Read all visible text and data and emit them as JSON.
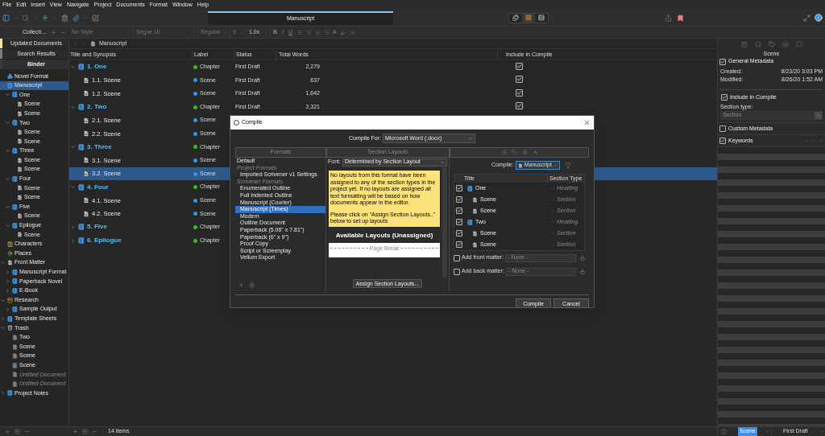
{
  "menu": [
    "File",
    "Edit",
    "Insert",
    "View",
    "Navigate",
    "Project",
    "Documents",
    "Format",
    "Window",
    "Help"
  ],
  "toolbar": {
    "title": "Manuscript",
    "view_modes": [
      {
        "kind": "pages",
        "selected": false
      },
      {
        "kind": "grid",
        "selected": true
      },
      {
        "kind": "rows",
        "selected": false
      }
    ]
  },
  "format_bar": {
    "style": "No Style",
    "font": "Segoe UI",
    "weight": "Regular",
    "size": "9",
    "spacing": "1.0x",
    "bold": "B",
    "italic": "I",
    "underline": "U",
    "text_color": "A"
  },
  "binder": {
    "header": "Collecti…",
    "collections": [
      {
        "label": "Updated Documents",
        "color": "#f3e5ab",
        "selected": false
      },
      {
        "label": "Search Results",
        "color": "#7a7a7a",
        "selected": false
      },
      {
        "label": "Binder",
        "color": "#3a3a3a",
        "selected": true
      }
    ],
    "items": [
      {
        "title": "Novel Format",
        "kind": "format",
        "selected": false
      },
      {
        "title": "Manuscript",
        "kind": "folder",
        "expanded": true,
        "selected": true,
        "children": [
          {
            "title": "One",
            "kind": "folder",
            "expanded": true,
            "selected": false,
            "children": [
              {
                "title": "Scene",
                "kind": "scene",
                "selected": false
              },
              {
                "title": "Scene",
                "kind": "scene",
                "selected": false
              }
            ]
          },
          {
            "title": "Two",
            "kind": "folder",
            "expanded": true,
            "selected": false,
            "children": [
              {
                "title": "Scene",
                "kind": "scene",
                "selected": false
              },
              {
                "title": "Scene",
                "kind": "scene",
                "selected": false
              }
            ]
          },
          {
            "title": "Three",
            "kind": "folder",
            "expanded": true,
            "selected": false,
            "children": [
              {
                "title": "Scene",
                "kind": "scene",
                "selected": false
              },
              {
                "title": "Scene",
                "kind": "scene",
                "selected": false
              }
            ]
          },
          {
            "title": "Four",
            "kind": "folder",
            "expanded": true,
            "selected": false,
            "children": [
              {
                "title": "Scene",
                "kind": "scene",
                "selected": false
              },
              {
                "title": "Scene",
                "kind": "scene",
                "selected": false
              }
            ]
          },
          {
            "title": "Five",
            "kind": "folder",
            "expanded": true,
            "selected": false,
            "children": [
              {
                "title": "Scene",
                "kind": "scene",
                "selected": false
              }
            ]
          },
          {
            "title": "Epilogue",
            "kind": "folder",
            "expanded": true,
            "selected": false,
            "children": [
              {
                "title": "Scene",
                "kind": "scene",
                "selected": false
              }
            ]
          }
        ]
      },
      {
        "title": "Characters",
        "kind": "characters",
        "selected": false
      },
      {
        "title": "Places",
        "kind": "places",
        "selected": false
      },
      {
        "title": "Front Matter",
        "kind": "scene",
        "expanded": true,
        "selected": false,
        "children": [
          {
            "title": "Manuscript Format",
            "kind": "folder",
            "expanded": false,
            "selected": false
          },
          {
            "title": "Paperback Novel",
            "kind": "folder",
            "expanded": false,
            "selected": false
          },
          {
            "title": "E-Book",
            "kind": "folder",
            "expanded": false,
            "selected": false
          }
        ]
      },
      {
        "title": "Research",
        "kind": "research",
        "expanded": true,
        "selected": false,
        "children": [
          {
            "title": "Sample Output",
            "kind": "folder",
            "expanded": false,
            "selected": false
          }
        ]
      },
      {
        "title": "Template Sheets",
        "kind": "folder",
        "expanded": false,
        "selected": false
      },
      {
        "title": "Trash",
        "kind": "trash",
        "expanded": true,
        "selected": false,
        "children": [
          {
            "title": "Two",
            "kind": "trashed",
            "selected": false
          },
          {
            "title": "Scene",
            "kind": "trashed",
            "selected": false
          },
          {
            "title": "Scene",
            "kind": "trashed",
            "selected": false
          },
          {
            "title": "Scene",
            "kind": "trashed-folder",
            "selected": false
          },
          {
            "title": "Untitled Document",
            "kind": "trashed",
            "dimmed": true,
            "selected": false
          },
          {
            "title": "Untitled Document",
            "kind": "trashed",
            "dimmed": true,
            "selected": false
          }
        ]
      },
      {
        "title": "Project Notes",
        "kind": "folder",
        "expanded": false,
        "selected": false
      }
    ]
  },
  "editor": {
    "breadcrumb": "Manuscript",
    "columns": [
      "Title and Synopsis",
      "Label",
      "Status",
      "Total Words",
      "Include in Compile"
    ],
    "rows": [
      {
        "title": "1. One",
        "kind": "chapter",
        "expanded": true,
        "label": "Chapter",
        "color": "#3cb521",
        "status": "First Draft",
        "words": "2,279",
        "include": true,
        "selected": false
      },
      {
        "title": "1.1. Scene",
        "kind": "scene",
        "label": "Scene",
        "color": "#3b8eea",
        "status": "First Draft",
        "words": "637",
        "include": true,
        "selected": false
      },
      {
        "title": "1.2. Scene",
        "kind": "scene",
        "label": "Scene",
        "color": "#3b8eea",
        "status": "First Draft",
        "words": "1,642",
        "include": true,
        "selected": false
      },
      {
        "title": "2. Two",
        "kind": "chapter",
        "expanded": true,
        "label": "Chapter",
        "color": "#3cb521",
        "status": "First Draft",
        "words": "2,321",
        "include": true,
        "selected": false
      },
      {
        "title": "2.1. Scene",
        "kind": "scene",
        "label": "Scene",
        "color": "#3b8eea",
        "selected": false
      },
      {
        "title": "2.2. Scene",
        "kind": "scene",
        "label": "Scene",
        "color": "#3b8eea",
        "selected": false
      },
      {
        "title": "3. Three",
        "kind": "chapter",
        "expanded": true,
        "label": "Chapter",
        "color": "#3cb521",
        "selected": false
      },
      {
        "title": "3.1. Scene",
        "kind": "scene",
        "label": "Scene",
        "color": "#3b8eea",
        "selected": false
      },
      {
        "title": "3.2. Scene",
        "kind": "scene",
        "label": "Scene",
        "color": "#3b8eea",
        "selected": true
      },
      {
        "title": "4. Four",
        "kind": "chapter",
        "expanded": true,
        "label": "Chapter",
        "color": "#3cb521",
        "selected": false
      },
      {
        "title": "4.1. Scene",
        "kind": "scene",
        "label": "Scene",
        "color": "#3b8eea",
        "selected": false
      },
      {
        "title": "4.2. Scene",
        "kind": "scene",
        "label": "Scene",
        "color": "#3b8eea",
        "selected": false
      },
      {
        "title": "5. Five",
        "kind": "chapter",
        "expanded": false,
        "label": "Chapter",
        "color": "#3cb521",
        "selected": false
      },
      {
        "title": "6. Epilogue",
        "kind": "chapter",
        "expanded": false,
        "label": "Chapter",
        "color": "#3cb521",
        "selected": false
      }
    ],
    "count": "14 items"
  },
  "inspector": {
    "title": "Scene",
    "general": {
      "label": "General Metadata",
      "checked": true
    },
    "created_label": "Created:",
    "created": "8/23/20 3:03 PM",
    "modified_label": "Modified:",
    "modified": "8/26/20 1:52 AM",
    "include": {
      "label": "Include in Compile",
      "checked": true
    },
    "section_type_label": "Section type:",
    "section_type": "Section",
    "section_type_disabled": true,
    "custom": {
      "label": "Custom Metadata",
      "checked": false
    },
    "keywords": {
      "label": "Keywords",
      "checked": true
    },
    "footer_label": "Scene",
    "footer_status": "First Draft"
  },
  "compile_dialog": {
    "title": "Compile",
    "compile_for_label": "Compile For:",
    "compile_for": "Microsoft Word (.docx)",
    "formats_header": "Formats",
    "layouts_header": "Section Layouts",
    "formats": [
      {
        "text": "Default",
        "kind": "top",
        "selected": false
      },
      {
        "text": "Project Formats",
        "kind": "group",
        "selected": false
      },
      {
        "text": "Imported Scrivener v1 Settings",
        "kind": "item",
        "selected": false
      },
      {
        "text": "Scrivener Formats",
        "kind": "group",
        "selected": false
      },
      {
        "text": "Enumerated Outline",
        "kind": "item",
        "selected": false
      },
      {
        "text": "Full Indented Outline",
        "kind": "item",
        "selected": false
      },
      {
        "text": "Manuscript (Courier)",
        "kind": "item",
        "selected": false
      },
      {
        "text": "Manuscript (Times)",
        "kind": "item",
        "selected": true
      },
      {
        "text": "Modern",
        "kind": "item",
        "selected": false
      },
      {
        "text": "Outline Document",
        "kind": "item",
        "selected": false
      },
      {
        "text": "Paperback (5.06\" x 7.81\")",
        "kind": "item",
        "selected": false
      },
      {
        "text": "Paperback (6\" x 9\")",
        "kind": "item",
        "selected": false
      },
      {
        "text": "Proof Copy",
        "kind": "item",
        "selected": false
      },
      {
        "text": "Script or Screenplay",
        "kind": "item",
        "selected": false
      },
      {
        "text": "Vellum Export",
        "kind": "item",
        "selected": false
      }
    ],
    "font_label": "Font:",
    "font": "Determined by Section Layout",
    "notice": [
      "No layouts from this format have been assigned to any of the section types in the project yet. If no layouts are assigned all text formatting will be based on how documents appear in the editor.",
      "Please click on \"Assign Section Layouts..\" below to set up layouts"
    ],
    "available_title": "Available Layouts (Unassigned)",
    "page_break": "Page Break",
    "assign_button": "Assign Section Layouts...",
    "compile_label": "Compile:",
    "compile_value": "Manuscript",
    "contents_columns": [
      "Title",
      "Section Type"
    ],
    "contents": [
      {
        "title": "One",
        "kind": "folder",
        "checked": true,
        "section_type": "Heading"
      },
      {
        "title": "Scene",
        "kind": "scene",
        "checked": true,
        "section_type": "Section"
      },
      {
        "title": "Scene",
        "kind": "scene",
        "checked": true,
        "section_type": "Section"
      },
      {
        "title": "Two",
        "kind": "folder",
        "checked": true,
        "section_type": "Heading"
      },
      {
        "title": "Scene",
        "kind": "scene",
        "checked": true,
        "section_type": "Section"
      },
      {
        "title": "Scene",
        "kind": "scene",
        "checked": true,
        "section_type": "Section"
      }
    ],
    "front_matter": {
      "label": "Add front matter:",
      "checked": false,
      "value": "- None -"
    },
    "back_matter": {
      "label": "Add back matter:",
      "checked": false,
      "value": "- None -"
    },
    "buttons": [
      "Compile",
      "Cancel"
    ]
  }
}
